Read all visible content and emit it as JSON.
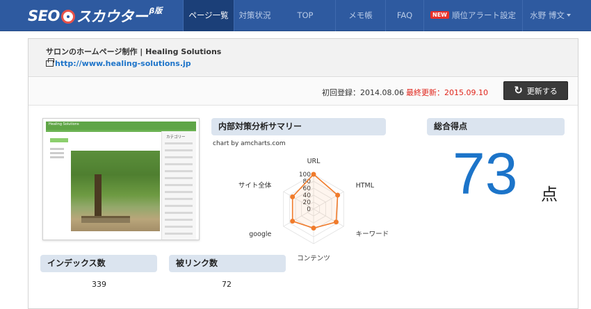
{
  "logo": {
    "text_left": "SEO",
    "text_right": "スカウター",
    "beta": "β版"
  },
  "nav": {
    "items": [
      {
        "label": "ページ一覧"
      },
      {
        "label": "対策状況"
      },
      {
        "label": "TOP"
      },
      {
        "label": "メモ帳"
      },
      {
        "label": "FAQ"
      },
      {
        "label": "順位アラート設定",
        "badge": "NEW"
      },
      {
        "label": "水野 博文"
      }
    ]
  },
  "site": {
    "title": "サロンのホームページ制作 | Healing Solutions",
    "url": "http://www.healing-solutions.jp"
  },
  "dates": {
    "first_registered": "初回登録：2014.08.06",
    "last_updated": "最終更新：2015.09.10",
    "refresh_label": "更新する"
  },
  "thumbnail": {
    "header_text": "Healing Solutions",
    "sidebar_title": "カテゴリー"
  },
  "summary": {
    "title": "内部対策分析サマリー",
    "credit": "chart by amcharts.com"
  },
  "chart_data": {
    "type": "radar",
    "categories": [
      "URL",
      "HTML",
      "キーワード",
      "コンテンツ",
      "google",
      "サイト全体"
    ],
    "values": [
      100,
      80,
      75,
      55,
      70,
      70
    ],
    "axis_ticks": [
      "0",
      "20",
      "40",
      "60",
      "80",
      "100"
    ],
    "ylim": [
      0,
      100
    ],
    "color": "#f07b2b"
  },
  "score": {
    "title": "総合得点",
    "value": "73",
    "unit": "点"
  },
  "stats": {
    "index_label": "インデックス数",
    "index_value": "339",
    "backlink_label": "被リンク数",
    "backlink_value": "72"
  },
  "colors": {
    "nav_bg": "#2e5aa0",
    "accent": "#1c74c9",
    "alert": "#e0251b"
  }
}
